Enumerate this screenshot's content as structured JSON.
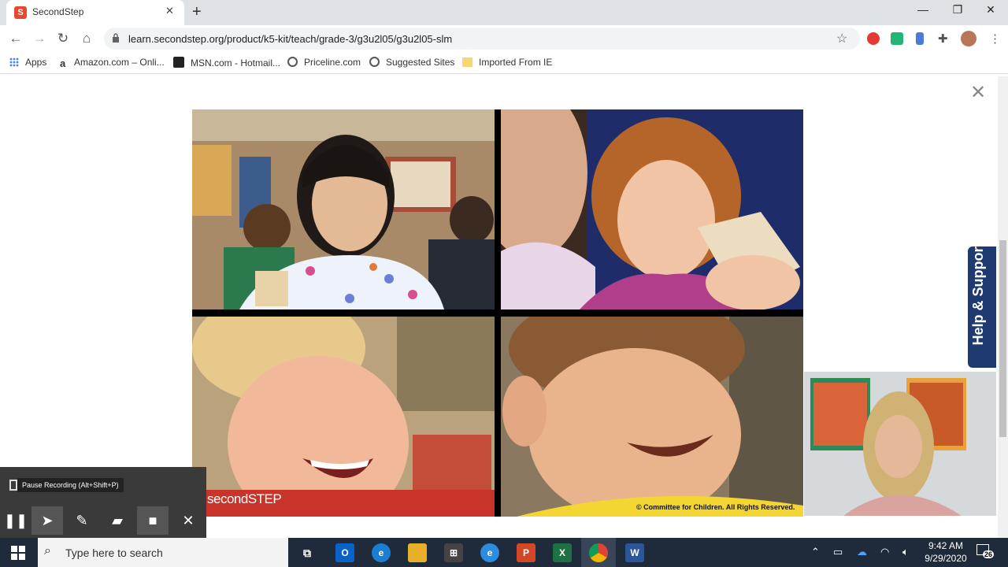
{
  "browser": {
    "tab_title": "SecondStep",
    "tab_favicon_letter": "S",
    "url": "learn.secondstep.org/product/k5-kit/teach/grade-3/g3u2l05/g3u2l05-slm",
    "bookmarks": [
      {
        "label": "Apps",
        "icon": "apps-grid-icon"
      },
      {
        "label": "Amazon.com – Onli...",
        "icon": "amazon-icon"
      },
      {
        "label": "MSN.com - Hotmail...",
        "icon": "msn-icon"
      },
      {
        "label": "Priceline.com",
        "icon": "globe-icon"
      },
      {
        "label": "Suggested Sites",
        "icon": "globe-icon"
      },
      {
        "label": "Imported From IE",
        "icon": "folder-icon"
      }
    ]
  },
  "slide": {
    "watermark": "secondSTEP",
    "copyright": "© Committee for Children. All Rights Reserved."
  },
  "help": {
    "label": "Help & Support"
  },
  "recording": {
    "tooltip": "Pause Recording (Alt+Shift+P)"
  },
  "taskbar": {
    "search_placeholder": "Type here to search",
    "time": "9:42 AM",
    "date": "9/29/2020",
    "notification_count": "26"
  },
  "colors": {
    "help_tab": "#1f3a70",
    "taskbar": "#1f2a3a",
    "brand": "#e8482d"
  }
}
